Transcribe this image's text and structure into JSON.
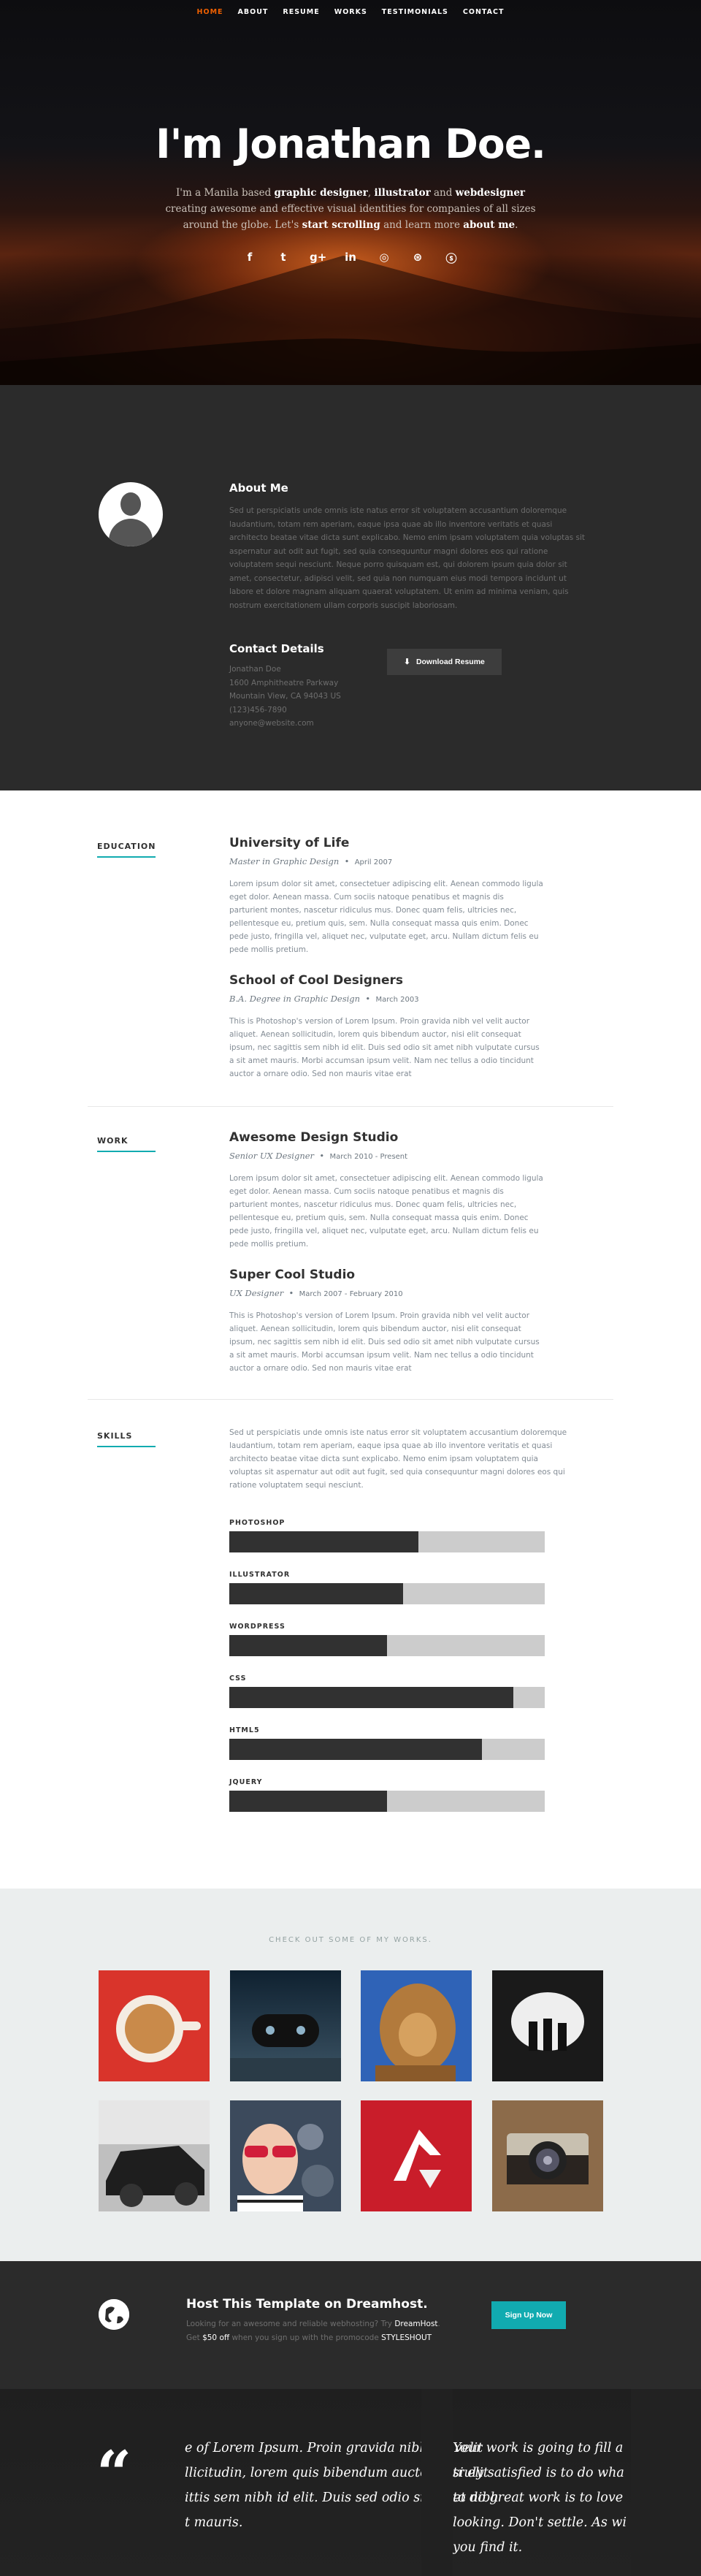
{
  "nav": {
    "items": [
      "Home",
      "About",
      "Resume",
      "Works",
      "Testimonials",
      "Contact"
    ]
  },
  "hero": {
    "headline": "I'm Jonathan Doe.",
    "intro_1": "I'm a Manila based ",
    "role_1": "graphic designer",
    "sep_1": ", ",
    "role_2": "illustrator",
    "sep_2": " and ",
    "role_3": "webdesigner",
    "intro_2": " creating awesome and effective visual identities for companies of all sizes around the globe. Let's ",
    "scroll_link": "start scrolling",
    "intro_3": " and learn more ",
    "about_link": "about me",
    "intro_4": ".",
    "social": [
      {
        "icon": "facebook-icon",
        "glyph": "f"
      },
      {
        "icon": "twitter-icon",
        "glyph": "t"
      },
      {
        "icon": "google-plus-icon",
        "glyph": "g+"
      },
      {
        "icon": "linkedin-icon",
        "glyph": "in"
      },
      {
        "icon": "instagram-icon",
        "glyph": "◎"
      },
      {
        "icon": "dribbble-icon",
        "glyph": "⊛"
      },
      {
        "icon": "skype-icon",
        "glyph": "ⓢ"
      }
    ],
    "scroll_glyph": "⌄"
  },
  "about": {
    "title": "About Me",
    "text": "Sed ut perspiciatis unde omnis iste natus error sit voluptatem accusantium doloremque laudantium, totam rem aperiam, eaque ipsa quae ab illo inventore veritatis et quasi architecto beatae vitae dicta sunt explicabo. Nemo enim ipsam voluptatem quia voluptas sit aspernatur aut odit aut fugit, sed quia consequuntur magni dolores eos qui ratione voluptatem sequi nesciunt. Neque porro quisquam est, qui dolorem ipsum quia dolor sit amet, consectetur, adipisci velit, sed quia non numquam eius modi tempora incidunt ut labore et dolore magnam aliquam quaerat voluptatem. Ut enim ad minima veniam, quis nostrum exercitationem ullam corporis suscipit laboriosam.",
    "contact_title": "Contact Details",
    "contact": [
      "Jonathan Doe",
      "1600 Amphitheatre Parkway",
      "Mountain View, CA 94043 US",
      "(123)456-7890",
      "anyone@website.com"
    ],
    "download_label": "Download Resume"
  },
  "education": {
    "label": "Education",
    "items": [
      {
        "title": "University of Life",
        "subtitle": "Master in Graphic Design",
        "date": "April 2007",
        "body": "Lorem ipsum dolor sit amet, consectetuer adipiscing elit. Aenean commodo ligula eget dolor. Aenean massa. Cum sociis natoque penatibus et magnis dis parturient montes, nascetur ridiculus mus. Donec quam felis, ultricies nec, pellentesque eu, pretium quis, sem. Nulla consequat massa quis enim. Donec pede justo, fringilla vel, aliquet nec, vulputate eget, arcu. Nullam dictum felis eu pede mollis pretium."
      },
      {
        "title": "School of Cool Designers",
        "subtitle": "B.A. Degree in Graphic Design",
        "date": "March 2003",
        "body": "This is Photoshop's version of Lorem Ipsum. Proin gravida nibh vel velit auctor aliquet. Aenean sollicitudin, lorem quis bibendum auctor, nisi elit consequat ipsum, nec sagittis sem nibh id elit. Duis sed odio sit amet nibh vulputate cursus a sit amet mauris. Morbi accumsan ipsum velit. Nam nec tellus a odio tincidunt auctor a ornare odio. Sed non mauris vitae erat"
      }
    ]
  },
  "work": {
    "label": "Work",
    "items": [
      {
        "title": "Awesome Design Studio",
        "subtitle": "Senior UX Designer",
        "date": "March 2010 - Present",
        "body": "Lorem ipsum dolor sit amet, consectetuer adipiscing elit. Aenean commodo ligula eget dolor. Aenean massa. Cum sociis natoque penatibus et magnis dis parturient montes, nascetur ridiculus mus. Donec quam felis, ultricies nec, pellentesque eu, pretium quis, sem. Nulla consequat massa quis enim. Donec pede justo, fringilla vel, aliquet nec, vulputate eget, arcu. Nullam dictum felis eu pede mollis pretium."
      },
      {
        "title": "Super Cool Studio",
        "subtitle": "UX Designer",
        "date": "March 2007 - February 2010",
        "body": "This is Photoshop's version of Lorem Ipsum. Proin gravida nibh vel velit auctor aliquet. Aenean sollicitudin, lorem quis bibendum auctor, nisi elit consequat ipsum, nec sagittis sem nibh id elit. Duis sed odio sit amet nibh vulputate cursus a sit amet mauris. Morbi accumsan ipsum velit. Nam nec tellus a odio tincidunt auctor a ornare odio. Sed non mauris vitae erat"
      }
    ]
  },
  "skills": {
    "label": "Skills",
    "text": "Sed ut perspiciatis unde omnis iste natus error sit voluptatem accusantium doloremque laudantium, totam rem aperiam, eaque ipsa quae ab illo inventore veritatis et quasi architecto beatae vitae dicta sunt explicabo. Nemo enim ipsam voluptatem quia voluptas sit aspernatur aut odit aut fugit, sed quia consequuntur magni dolores eos qui ratione voluptatem sequi nesciunt.",
    "items": [
      {
        "name": "PHOTOSHOP",
        "level": 0.6
      },
      {
        "name": "ILLUSTRATOR",
        "level": 0.55
      },
      {
        "name": "WORDPRESS",
        "level": 0.5
      },
      {
        "name": "CSS",
        "level": 0.9
      },
      {
        "name": "HTML5",
        "level": 0.8
      },
      {
        "name": "JQUERY",
        "level": 0.5
      }
    ]
  },
  "portfolio": {
    "title": "Check Out Some of My Works.",
    "items": [
      {
        "name": "coffee-cup-image"
      },
      {
        "name": "console-controller-image"
      },
      {
        "name": "judah-lion-image"
      },
      {
        "name": "into-the-light-image"
      },
      {
        "name": "vintage-car-image"
      },
      {
        "name": "woman-with-sunglasses-image"
      },
      {
        "name": "red-arrow-logo-image"
      },
      {
        "name": "retro-camera-image"
      }
    ]
  },
  "cta": {
    "title": "Host This Template on Dreamhost.",
    "line1_a": "Looking for an awesome and reliable webhosting? Try ",
    "line1_b": "DreamHost",
    "line1_c": ".",
    "line2_a": "Get ",
    "line2_b": "$50 off",
    "line2_c": " when you sign up with the promocode ",
    "line2_d": "STYLESHOUT",
    "signup_label": "Sign Up Now"
  },
  "testimonials": {
    "quote_glyph": "“",
    "quote_a": [
      "e of Lorem Ipsum. Proin gravida nibh vel velit",
      "llicitudin, lorem quis bibendum auctor, nisi elit",
      "ittis sem nibh id elit. Duis sed odio sit amet nibh",
      "t mauris."
    ],
    "quote_b": [
      "Your work is going to fill a",
      "truly satisfied is to do wha",
      "to do great work is to love",
      "looking. Don't settle. As wi",
      "you find it."
    ]
  },
  "colors": {
    "accent": "#11abb0",
    "nav_active": "#f06000",
    "dark_bg": "#2b2b2b"
  }
}
